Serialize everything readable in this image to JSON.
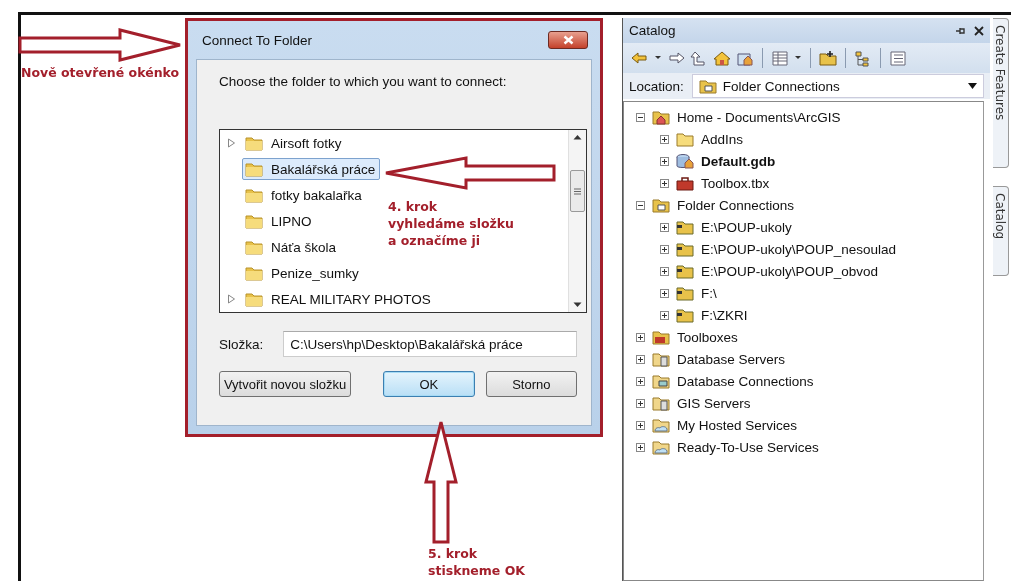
{
  "annotations": [
    {
      "lines": [
        "Nově otevřené okénko"
      ]
    },
    {
      "lines": [
        "4. krok",
        "vyhledáme složku",
        "a označíme ji"
      ]
    },
    {
      "lines": [
        "5. krok",
        "stiskneme OK"
      ]
    }
  ],
  "dialog": {
    "title": "Connect To Folder",
    "prompt": "Choose the folder to which you want to connect:",
    "folders": [
      {
        "name": "Airsoft fotky",
        "expandable": true,
        "selected": false
      },
      {
        "name": "Bakalářská práce",
        "expandable": false,
        "selected": true
      },
      {
        "name": "fotky bakalařka",
        "expandable": false,
        "selected": false
      },
      {
        "name": "LIPNO",
        "expandable": false,
        "selected": false
      },
      {
        "name": "Náťa škola",
        "expandable": false,
        "selected": false
      },
      {
        "name": "Penize_sumky",
        "expandable": false,
        "selected": false
      },
      {
        "name": "REAL MILITARY PHOTOS",
        "expandable": true,
        "selected": false
      }
    ],
    "folder_label": "Složka:",
    "folder_value": "C:\\Users\\hp\\Desktop\\Bakalářská práce",
    "buttons": [
      {
        "label": "Vytvořit novou složku",
        "default": false
      },
      {
        "label": "OK",
        "default": true
      },
      {
        "label": "Storno",
        "default": false
      }
    ]
  },
  "catalog": {
    "title": "Catalog",
    "location_label": "Location:",
    "location_value": "Folder Connections",
    "tree": [
      {
        "name": "Home - Documents\\ArcGIS",
        "kind": "home",
        "expanded": true,
        "children": [
          {
            "name": "AddIns",
            "kind": "folder",
            "expanded": false
          },
          {
            "name": "Default.gdb",
            "kind": "gdb",
            "expanded": false
          },
          {
            "name": "Toolbox.tbx",
            "kind": "toolbox",
            "expanded": false
          }
        ]
      },
      {
        "name": "Folder Connections",
        "kind": "connections",
        "expanded": true,
        "children": [
          {
            "name": "E:\\POUP-ukoly",
            "kind": "connection",
            "expanded": false
          },
          {
            "name": "E:\\POUP-ukoly\\POUP_nesoulad",
            "kind": "connection",
            "expanded": false
          },
          {
            "name": "E:\\POUP-ukoly\\POUP_obvod",
            "kind": "connection",
            "expanded": false
          },
          {
            "name": "F:\\",
            "kind": "connection",
            "expanded": false
          },
          {
            "name": "F:\\ZKRI",
            "kind": "connection",
            "expanded": false
          }
        ]
      },
      {
        "name": "Toolboxes",
        "kind": "toolboxes",
        "expanded": false
      },
      {
        "name": "Database Servers",
        "kind": "server",
        "expanded": false
      },
      {
        "name": "Database Connections",
        "kind": "dbconn",
        "expanded": false
      },
      {
        "name": "GIS Servers",
        "kind": "server",
        "expanded": false
      },
      {
        "name": "My Hosted Services",
        "kind": "cloud",
        "expanded": false
      },
      {
        "name": "Ready-To-Use Services",
        "kind": "cloud",
        "expanded": false
      }
    ]
  },
  "side_tabs": [
    "Create Features",
    "Catalog"
  ]
}
